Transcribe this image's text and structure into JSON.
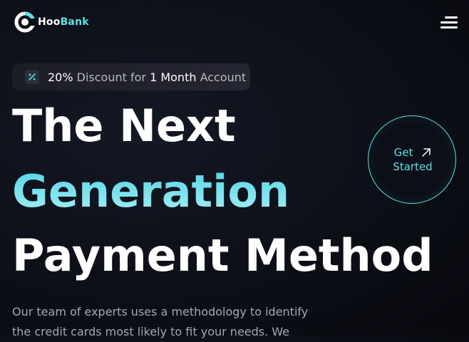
{
  "brand": {
    "name_part1": "Hoo",
    "name_part2": "Bank"
  },
  "nav": {
    "menu_icon": "hamburger-menu-icon"
  },
  "promo": {
    "icon": "discount-percent-icon",
    "percent": "20%",
    "text1": " Discount for ",
    "highlight": "1 Month",
    "text2": " Account"
  },
  "hero": {
    "line1": "The Next",
    "line2": "Generation",
    "line3": "Payment Method"
  },
  "cta": {
    "line1": "Get",
    "line2": "Started",
    "icon": "arrow-up-right-icon"
  },
  "description": {
    "line1": "Our team of experts uses a methodology to identify",
    "line2": "the credit cards most likely to fit your needs. We"
  },
  "colors": {
    "accent": "#5ce1e6",
    "background": "#0b0d14",
    "text_muted": "#a6a8b2"
  }
}
